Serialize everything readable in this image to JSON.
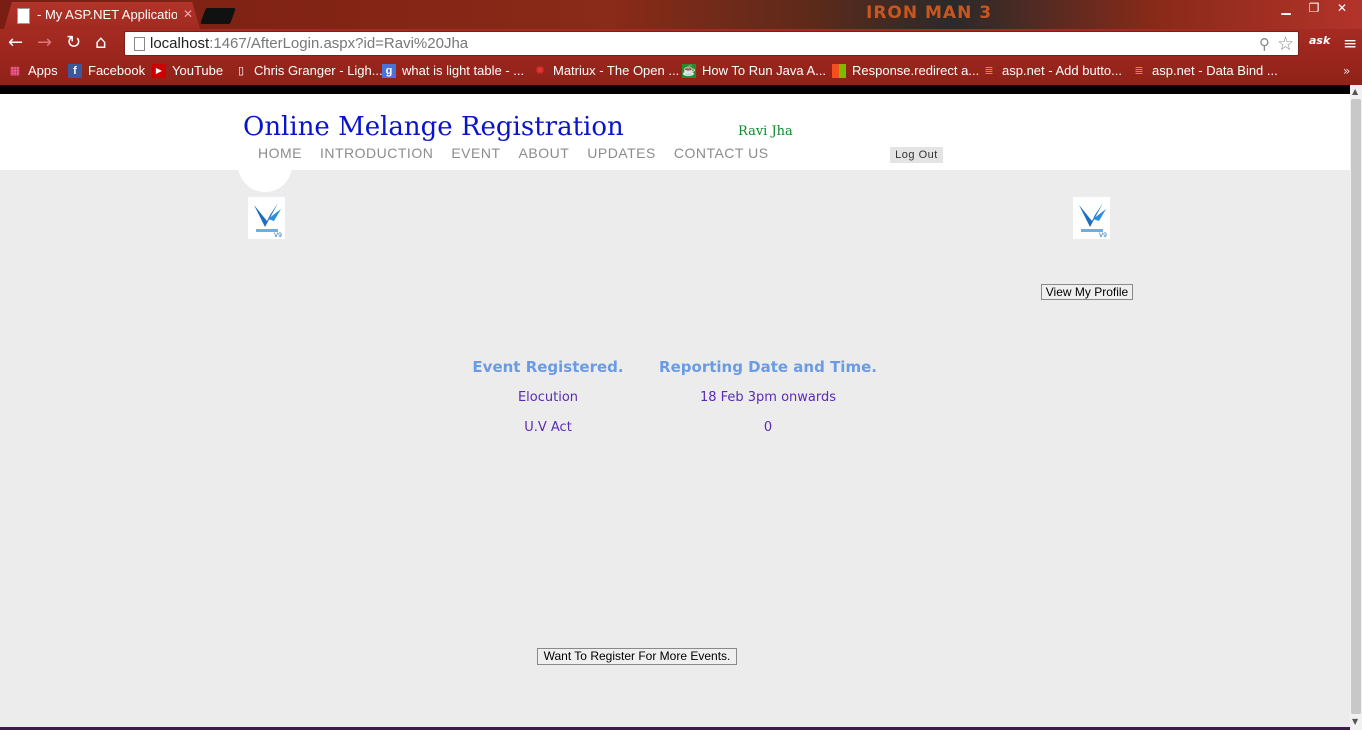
{
  "browser": {
    "tab_title": "- My ASP.NET Application",
    "url_host": "localhost",
    "url_rest": ":1467/AfterLogin.aspx?id=Ravi%20Jha",
    "brand_banner": "IRON MAN 3",
    "bookmarks": [
      {
        "label": "Apps",
        "icon": "apps-grid-icon"
      },
      {
        "label": "Facebook",
        "icon": "facebook-icon"
      },
      {
        "label": "YouTube",
        "icon": "youtube-icon"
      },
      {
        "label": "Chris Granger - Ligh...",
        "icon": "page-icon"
      },
      {
        "label": "what is light table - ...",
        "icon": "google-icon"
      },
      {
        "label": "Matriux - The Open ...",
        "icon": "matriux-icon"
      },
      {
        "label": "How To Run Java A...",
        "icon": "java-icon"
      },
      {
        "label": "Response.redirect a...",
        "icon": "microsoft-icon"
      },
      {
        "label": "asp.net - Add butto...",
        "icon": "stackoverflow-icon"
      },
      {
        "label": "asp.net - Data Bind ...",
        "icon": "stackoverflow-icon"
      }
    ]
  },
  "header": {
    "site_title": "Online Melange Registration",
    "user_name": "Ravi Jha",
    "logout_label": "Log Out",
    "menu": [
      "HOME",
      "INTRODUCTION",
      "EVENT",
      "ABOUT",
      "UPDATES",
      "CONTACT US"
    ]
  },
  "main": {
    "profile_button": "View My Profile",
    "register_button": "Want To Register For More Events.",
    "table": {
      "headers": [
        "Event Registered.",
        "Reporting Date and Time."
      ],
      "rows": [
        [
          "Elocution",
          "18 Feb 3pm onwards"
        ],
        [
          "U.V Act",
          "0"
        ]
      ]
    }
  },
  "colors": {
    "title_blue": "#0a14c8",
    "user_green": "#0b8b2a",
    "header_blue": "#6a9be4",
    "cell_purple": "#5a2bb5",
    "chrome_red": "#a52b22"
  }
}
